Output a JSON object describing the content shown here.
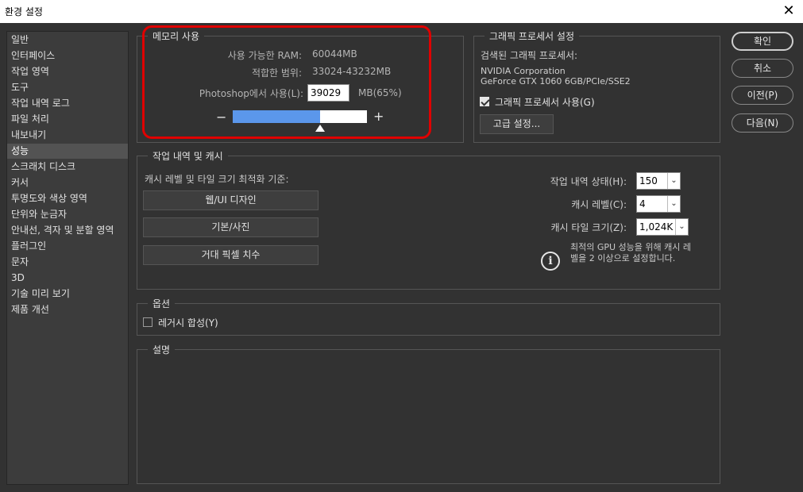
{
  "window": {
    "title": "환경 설정",
    "close_glyph": "✕"
  },
  "sidebar": {
    "items": [
      {
        "label": "일반"
      },
      {
        "label": "인터페이스"
      },
      {
        "label": "작업 영역"
      },
      {
        "label": "도구"
      },
      {
        "label": "작업 내역 로그"
      },
      {
        "label": "파일 처리"
      },
      {
        "label": "내보내기"
      },
      {
        "label": "성능",
        "selected": true
      },
      {
        "label": "스크래치 디스크"
      },
      {
        "label": "커서"
      },
      {
        "label": "투명도와 색상 영역"
      },
      {
        "label": "단위와 눈금자"
      },
      {
        "label": "안내선, 격자 및 분할 영역"
      },
      {
        "label": "플러그인"
      },
      {
        "label": "문자"
      },
      {
        "label": "3D"
      },
      {
        "label": "기술 미리 보기"
      },
      {
        "label": "제품 개선"
      }
    ]
  },
  "memory": {
    "title": "메모리 사용",
    "available_label": "사용 가능한 RAM:",
    "available_value": "60044MB",
    "range_label": "적합한 범위:",
    "range_value": "33024-43232MB",
    "use_label": "Photoshop에서 사용(L):",
    "use_value": "39029",
    "use_unit": "MB(65%)",
    "slider_percent": 65,
    "minus_glyph": "−",
    "plus_glyph": "+"
  },
  "gpu": {
    "title": "그래픽 프로세서 설정",
    "detected_label": "검색된 그래픽 프로세서:",
    "vendor": "NVIDIA Corporation",
    "model": "GeForce GTX 1060 6GB/PCIe/SSE2",
    "use_gpu_label": "그래픽 프로세서 사용(G)",
    "use_gpu_checked": true,
    "advanced_button": "고급 설정..."
  },
  "history": {
    "title": "작업 내역 및 캐시",
    "optimize_label": "캐시 레벨 및 타일 크기 최적화 기준:",
    "btn_web": "웹/UI 디자인",
    "btn_photo": "기본/사진",
    "btn_huge": "거대 픽셀 치수",
    "states_label": "작업 내역 상태(H):",
    "states_value": "150",
    "cache_levels_label": "캐시 레벨(C):",
    "cache_levels_value": "4",
    "tile_size_label": "캐시 타일 크기(Z):",
    "tile_size_value": "1,024K",
    "info_line1": "최적의 GPU 성능을 위해 캐시 레",
    "info_line2": "벨을 2 이상으로 설정합니다.",
    "info_glyph": "i",
    "spin_glyph": "⌄"
  },
  "options": {
    "title": "옵션",
    "legacy_label": "레거시 합성(Y)",
    "legacy_checked": false
  },
  "description": {
    "title": "설명"
  },
  "buttons": {
    "ok": "확인",
    "cancel": "취소",
    "prev": "이전(P)",
    "next": "다음(N)"
  },
  "colors": {
    "background": "#323232",
    "highlight": "#e00000",
    "slider_fill": "#5b97eb"
  }
}
